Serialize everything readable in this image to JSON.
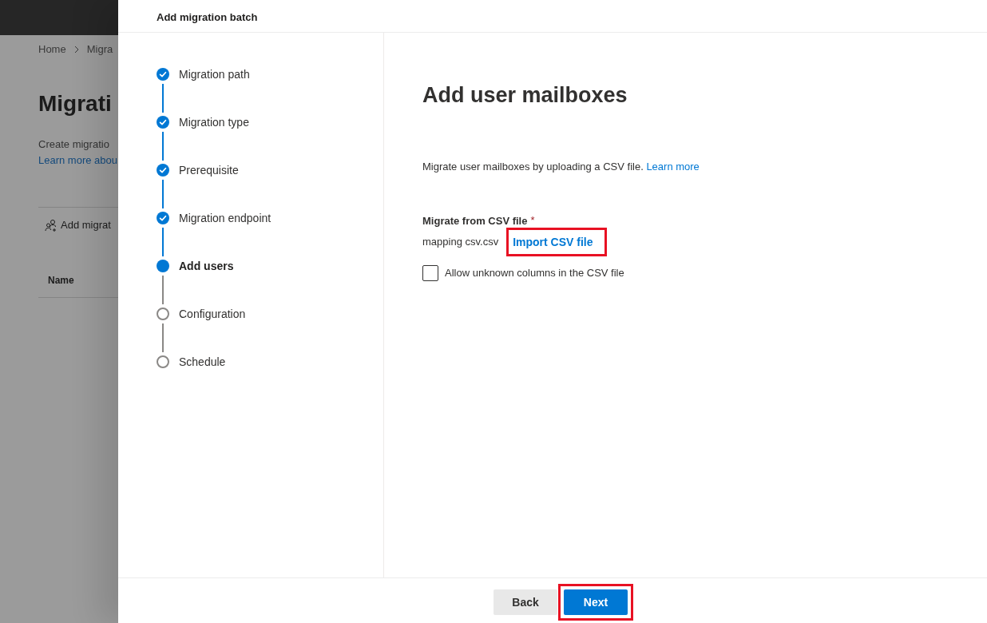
{
  "background_page": {
    "breadcrumb": [
      "Home",
      "Migra"
    ],
    "heading": "Migrati",
    "description": "Create migratio",
    "learn_more_link": "Learn more abou",
    "toolbar": {
      "add_button": "Add migrat"
    },
    "table": {
      "columns": [
        "Name"
      ]
    }
  },
  "panel": {
    "title": "Add migration batch",
    "steps": [
      {
        "label": "Migration path",
        "completed": true,
        "current": false
      },
      {
        "label": "Migration type",
        "completed": true,
        "current": false
      },
      {
        "label": "Prerequisite",
        "completed": true,
        "current": false
      },
      {
        "label": "Migration endpoint",
        "completed": true,
        "current": false
      },
      {
        "label": "Add users",
        "completed": false,
        "current": true
      },
      {
        "label": "Configuration",
        "completed": false,
        "current": false
      },
      {
        "label": "Schedule",
        "completed": false,
        "current": false
      }
    ],
    "content": {
      "heading": "Add user mailboxes",
      "description": "Migrate user mailboxes by uploading a CSV file.",
      "learn_more_link": "Learn more",
      "csv": {
        "label": "Migrate from CSV file",
        "required_mark": "*",
        "file_name": "mapping csv.csv",
        "import_link": {
          "label": "Import CSV file",
          "highlighted": true
        }
      },
      "allow_unknown_columns": {
        "label": "Allow unknown columns in the CSV file",
        "checked": false
      }
    },
    "footer": {
      "buttons": [
        {
          "label": "Back",
          "kind": "secondary",
          "highlighted": false
        },
        {
          "label": "Next",
          "kind": "primary",
          "highlighted": true
        }
      ]
    }
  }
}
